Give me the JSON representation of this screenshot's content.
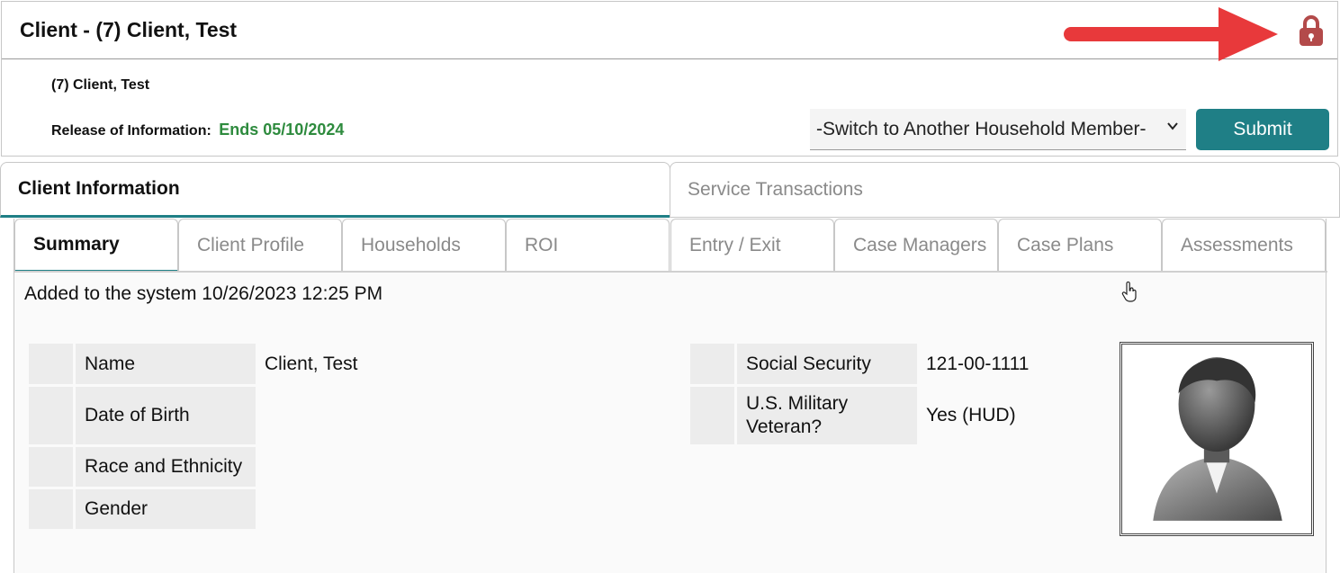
{
  "header": {
    "title": "Client - (7) Client, Test",
    "client_name": "(7) Client, Test",
    "roi_label": "Release of Information:",
    "roi_value": "Ends 05/10/2024",
    "household_select": "-Switch to Another Household Member-",
    "submit_label": "Submit",
    "lock_icon": "lock-icon",
    "colors": {
      "accent": "#1f7f86",
      "roi_green": "#2e8b3e",
      "lock_red": "#b34a4a",
      "annotation_arrow": "#e8393b"
    }
  },
  "outer_tabs": [
    {
      "label": "Client Information",
      "active": true
    },
    {
      "label": "Service Transactions",
      "active": false
    }
  ],
  "inner_tabs": [
    {
      "label": "Summary",
      "active": true
    },
    {
      "label": "Client Profile",
      "active": false
    },
    {
      "label": "Households",
      "active": false
    },
    {
      "label": "ROI",
      "active": false
    },
    {
      "label": "Entry / Exit",
      "active": false
    },
    {
      "label": "Case Managers",
      "active": false
    },
    {
      "label": "Case Plans",
      "active": false
    },
    {
      "label": "Assessments",
      "active": false
    }
  ],
  "summary": {
    "added_text": "Added to the system 10/26/2023 12:25 PM",
    "left_fields": [
      {
        "label": "Name",
        "value": "Client, Test"
      },
      {
        "label": "Date of Birth",
        "value": ""
      },
      {
        "label": "Race and Ethnicity",
        "value": ""
      },
      {
        "label": "Gender",
        "value": ""
      }
    ],
    "right_fields": [
      {
        "label": "Social Security",
        "value": "121-00-1111"
      },
      {
        "label": "U.S. Military Veteran?",
        "value": "Yes (HUD)"
      }
    ],
    "photo_icon": "person-silhouette-icon"
  }
}
